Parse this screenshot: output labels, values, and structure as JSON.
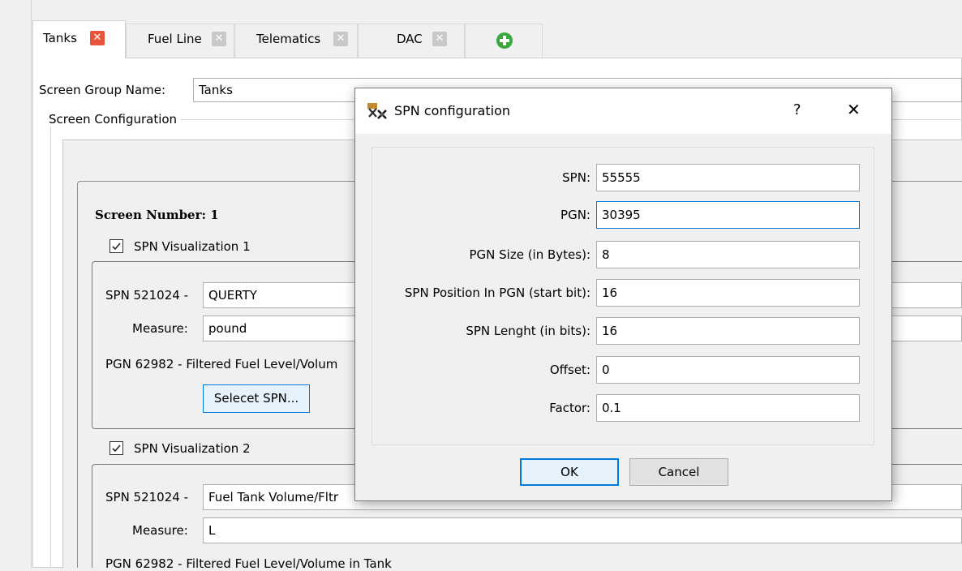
{
  "tabs": [
    {
      "label": "Tanks",
      "close": "✕",
      "close_color": "#e8533a"
    },
    {
      "label": "Fuel Line",
      "close": "✕",
      "close_color": "#c8c8c8"
    },
    {
      "label": "Telematics",
      "close": "✕",
      "close_color": "#c8c8c8"
    },
    {
      "label": "DAC",
      "close": "✕",
      "close_color": "#c8c8c8"
    }
  ],
  "add_tab_icon": "plus-circle-icon",
  "screen_group": {
    "label": "Screen Group Name:",
    "value": "Tanks"
  },
  "screen_config": {
    "label": "Screen Configuration"
  },
  "screen": {
    "title": "Screen Number: 1",
    "vis1": {
      "label": "SPN Visualization 1",
      "checked": true,
      "spn_label": "SPN 521024 -",
      "spn_value": "QUERTY",
      "measure_label": "Measure:",
      "measure_value": "pound",
      "pgn_text": "PGN 62982 - Filtered Fuel Level/Volum",
      "select_button": "Selecet SPN..."
    },
    "vis2": {
      "label": "SPN Visualization 2",
      "checked": true,
      "spn_label": "SPN 521024 -",
      "spn_value": "Fuel Tank Volume/Fltr",
      "measure_label": "Measure:",
      "measure_value": "L",
      "pgn_text": "PGN 62982 - Filtered Fuel Level/Volume in Tank"
    }
  },
  "dialog": {
    "title": "SPN configuration",
    "help": "?",
    "close": "✕",
    "fields": [
      {
        "label": "SPN:",
        "value": "55555"
      },
      {
        "label": "PGN:",
        "value": "30395"
      },
      {
        "label": "PGN Size (in Bytes):",
        "value": "8"
      },
      {
        "label": "SPN Position In PGN (start bit):",
        "value": "16"
      },
      {
        "label": "SPN Lenght (in bits):",
        "value": "16"
      },
      {
        "label": "Offset:",
        "value": "0"
      },
      {
        "label": "Factor:",
        "value": "0.1"
      }
    ],
    "ok": "OK",
    "cancel": "Cancel",
    "accent": "#0078d7"
  },
  "colors": {
    "add_icon": "#3aa83a"
  }
}
